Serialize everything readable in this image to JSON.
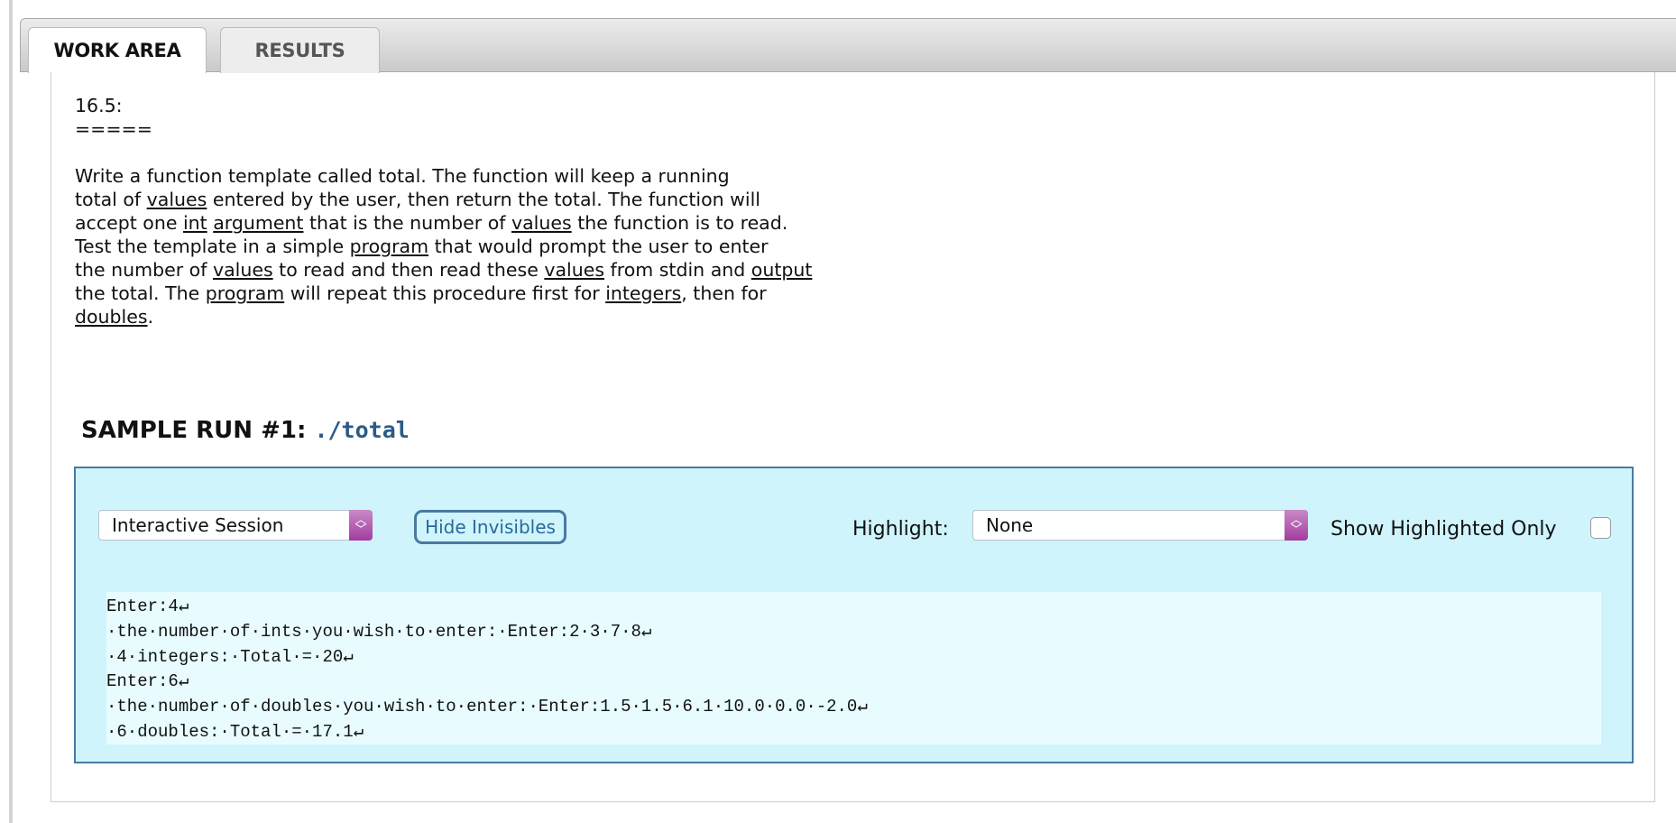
{
  "tabs": [
    {
      "label": "WORK AREA",
      "active": true
    },
    {
      "label": "RESULTS",
      "active": false
    }
  ],
  "problem": {
    "number": "16.5:",
    "underline": "=====",
    "lines": [
      [
        {
          "text": "Write a function template called total. The function will keep a running",
          "link": false
        }
      ],
      [
        {
          "text": "total of ",
          "link": false
        },
        {
          "text": "values",
          "link": true
        },
        {
          "text": " entered by the user, then return the total. The function will",
          "link": false
        }
      ],
      [
        {
          "text": "accept one ",
          "link": false
        },
        {
          "text": "int",
          "link": true
        },
        {
          "text": " ",
          "link": false
        },
        {
          "text": "argument",
          "link": true
        },
        {
          "text": " that is the number of ",
          "link": false
        },
        {
          "text": "values",
          "link": true
        },
        {
          "text": " the function is to read.",
          "link": false
        }
      ],
      [
        {
          "text": "Test the template in a simple ",
          "link": false
        },
        {
          "text": "program",
          "link": true
        },
        {
          "text": " that would prompt the user to enter",
          "link": false
        }
      ],
      [
        {
          "text": "the number of ",
          "link": false
        },
        {
          "text": "values",
          "link": true
        },
        {
          "text": " to read and then read these ",
          "link": false
        },
        {
          "text": "values",
          "link": true
        },
        {
          "text": " from stdin and ",
          "link": false
        },
        {
          "text": "output",
          "link": true
        }
      ],
      [
        {
          "text": "the total. The ",
          "link": false
        },
        {
          "text": "program",
          "link": true
        },
        {
          "text": " will repeat this procedure first for ",
          "link": false
        },
        {
          "text": "integers",
          "link": true
        },
        {
          "text": ", then for",
          "link": false
        }
      ],
      [
        {
          "text": "doubles",
          "link": true
        },
        {
          "text": ".",
          "link": false
        }
      ]
    ]
  },
  "sample_run": {
    "title": "SAMPLE RUN #1: ",
    "command": "./total",
    "session_select": "Interactive Session",
    "hide_invisibles_label": "Hide Invisibles",
    "highlight_label": "Highlight:",
    "highlight_select": "None",
    "show_highlighted_only_label": "Show Highlighted Only",
    "show_highlighted_only_checked": false,
    "console_lines": [
      "Enter:4↵",
      "·the·number·of·ints·you·wish·to·enter:·Enter:2·3·7·8↵",
      "·4·integers:·Total·=·20↵",
      "Enter:6↵",
      "·the·number·of·doubles·you·wish·to·enter:·Enter:1.5·1.5·6.1·10.0·0.0·-2.0↵",
      "·6·doubles:·Total·=·17.1↵"
    ]
  },
  "colors": {
    "accent": "#4a7aa0",
    "run_box_bg": "#cff4fc",
    "console_bg": "#e8fcff",
    "select_arrow": "#a23d9e"
  }
}
